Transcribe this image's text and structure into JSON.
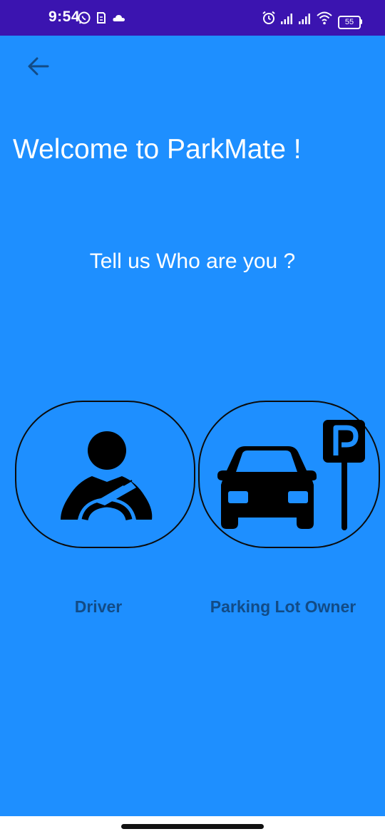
{
  "status_bar": {
    "time": "9:54",
    "battery": "55",
    "icons": [
      "whatsapp-icon",
      "sim-icon",
      "cloud-icon",
      "alarm-icon",
      "signal-icon",
      "signal-icon",
      "wifi-icon",
      "battery-icon"
    ]
  },
  "header": {
    "back_icon": "arrow-left-icon"
  },
  "main": {
    "title": "Welcome to ParkMate !",
    "subtitle": "Tell us Who are you ?",
    "roles": [
      {
        "label": "Driver",
        "icon": "driver-steering-icon"
      },
      {
        "label": "Parking Lot Owner",
        "icon": "car-parking-sign-icon"
      }
    ]
  },
  "colors": {
    "background": "#1E8FFF",
    "status_bar": "#3B14B0",
    "label_text": "#124B86",
    "title_text": "#FFFFFF"
  }
}
